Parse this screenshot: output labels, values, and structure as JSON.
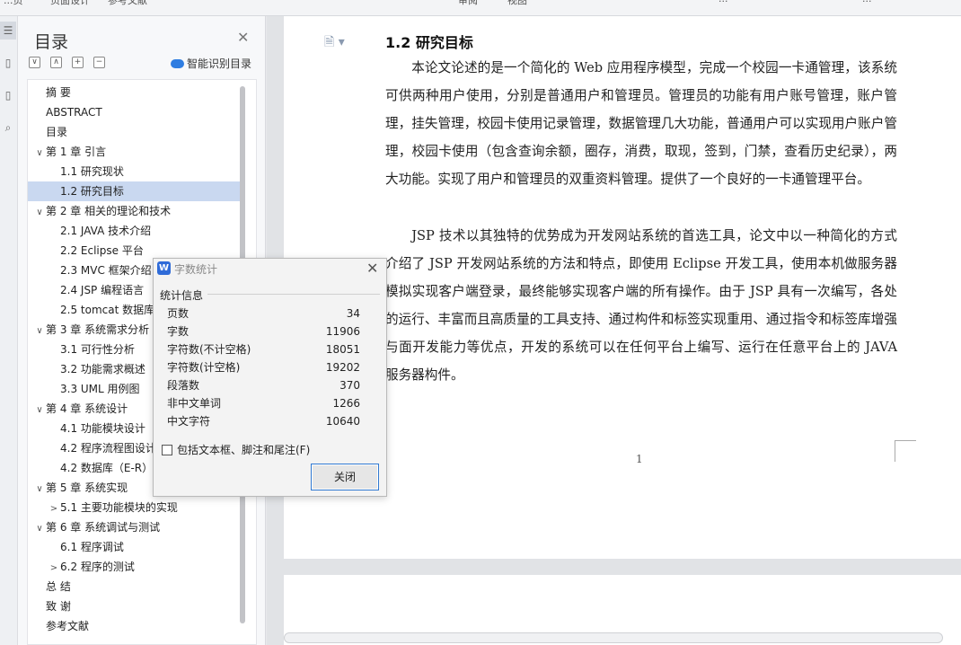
{
  "topbar": {
    "items": [
      "...页",
      "页面设计",
      "参考文献",
      "审阅",
      "视图",
      "...",
      "..."
    ]
  },
  "toc": {
    "title": "目录",
    "smart_label": "智能识别目录",
    "items": [
      {
        "label": "摘  要",
        "level": 1,
        "caret": ""
      },
      {
        "label": "ABSTRACT",
        "level": 1,
        "caret": ""
      },
      {
        "label": "目录",
        "level": 1,
        "caret": ""
      },
      {
        "label": "第 1 章  引言",
        "level": 1,
        "caret": "∨"
      },
      {
        "label": "1.1 研究现状",
        "level": 2,
        "caret": ""
      },
      {
        "label": "1.2 研究目标",
        "level": 2,
        "caret": "",
        "selected": true
      },
      {
        "label": "第 2 章  相关的理论和技术",
        "level": 1,
        "caret": "∨"
      },
      {
        "label": "2.1 JAVA 技术介绍",
        "level": 2,
        "caret": ""
      },
      {
        "label": "2.2 Eclipse 平台",
        "level": 2,
        "caret": ""
      },
      {
        "label": "2.3 MVC 框架介绍",
        "level": 2,
        "caret": ""
      },
      {
        "label": "2.4 JSP 编程语言",
        "level": 2,
        "caret": ""
      },
      {
        "label": "2.5 tomcat 数据库",
        "level": 2,
        "caret": ""
      },
      {
        "label": "第 3 章  系统需求分析",
        "level": 1,
        "caret": "∨"
      },
      {
        "label": "3.1 可行性分析",
        "level": 2,
        "caret": ""
      },
      {
        "label": "3.2 功能需求概述",
        "level": 2,
        "caret": ""
      },
      {
        "label": "3.3 UML 用例图",
        "level": 2,
        "caret": ""
      },
      {
        "label": "第 4 章  系统设计",
        "level": 1,
        "caret": "∨"
      },
      {
        "label": "4.1 功能模块设计",
        "level": 2,
        "caret": ""
      },
      {
        "label": "4.2 程序流程图设计",
        "level": 2,
        "caret": ""
      },
      {
        "label": "4.2 数据库（E-R）",
        "level": 2,
        "caret": ""
      },
      {
        "label": "第 5 章  系统实现",
        "level": 1,
        "caret": "∨"
      },
      {
        "label": "5.1 主要功能模块的实现",
        "level": 2,
        "caret": ">"
      },
      {
        "label": "第 6 章  系统调试与测试",
        "level": 1,
        "caret": "∨"
      },
      {
        "label": "6.1 程序调试",
        "level": 2,
        "caret": ""
      },
      {
        "label": "6.2 程序的测试",
        "level": 2,
        "caret": ">"
      },
      {
        "label": "总  结",
        "level": 1,
        "caret": ""
      },
      {
        "label": "致  谢",
        "level": 1,
        "caret": ""
      },
      {
        "label": "参考文献",
        "level": 1,
        "caret": ""
      }
    ]
  },
  "document": {
    "heading": "1.2 研究目标",
    "paragraphs": [
      "本论文论述的是一个简化的 Web 应用程序模型，完成一个校园一卡通管理，该系统可供两种用户使用，分别是普通用户和管理员。管理员的功能有用户账号管理，账户管理，挂失管理，校园卡使用记录管理，数据管理几大功能，普通用户可以实现用户账户管理，校园卡使用（包含查询余额，圈存，消费，取现，签到，门禁，查看历史纪录），两大功能。实现了用户和管理员的双重资料管理。提供了一个良好的一卡通管理平台。",
      "JSP 技术以其独特的优势成为开发网站系统的首选工具，论文中以一种简化的方式介绍了 JSP 开发网站系统的方法和特点，即使用 Eclipse 开发工具，使用本机做服务器模拟实现客户端登录，最终能够实现客户端的所有操作。由于 JSP 具有一次编写，各处的运行、丰富而且高质量的工具支持、通过构件和标签实现重用、通过指令和标签库增强与面开发能力等优点，开发的系统可以在任何平台上编写、运行在任意平台上的 JAVA 服务器构件。"
    ],
    "page_number": "1"
  },
  "dialog": {
    "logo": "W",
    "title": "字数统计",
    "section": "统计信息",
    "stats": [
      {
        "label": "页数",
        "value": "34"
      },
      {
        "label": "字数",
        "value": "11906"
      },
      {
        "label": "字符数(不计空格)",
        "value": "18051"
      },
      {
        "label": "字符数(计空格)",
        "value": "19202"
      },
      {
        "label": "段落数",
        "value": "370"
      },
      {
        "label": "非中文单词",
        "value": "1266"
      },
      {
        "label": "中文字符",
        "value": "10640"
      }
    ],
    "checkbox_label": "包括文本框、脚注和尾注(F)",
    "close_button": "关闭"
  }
}
